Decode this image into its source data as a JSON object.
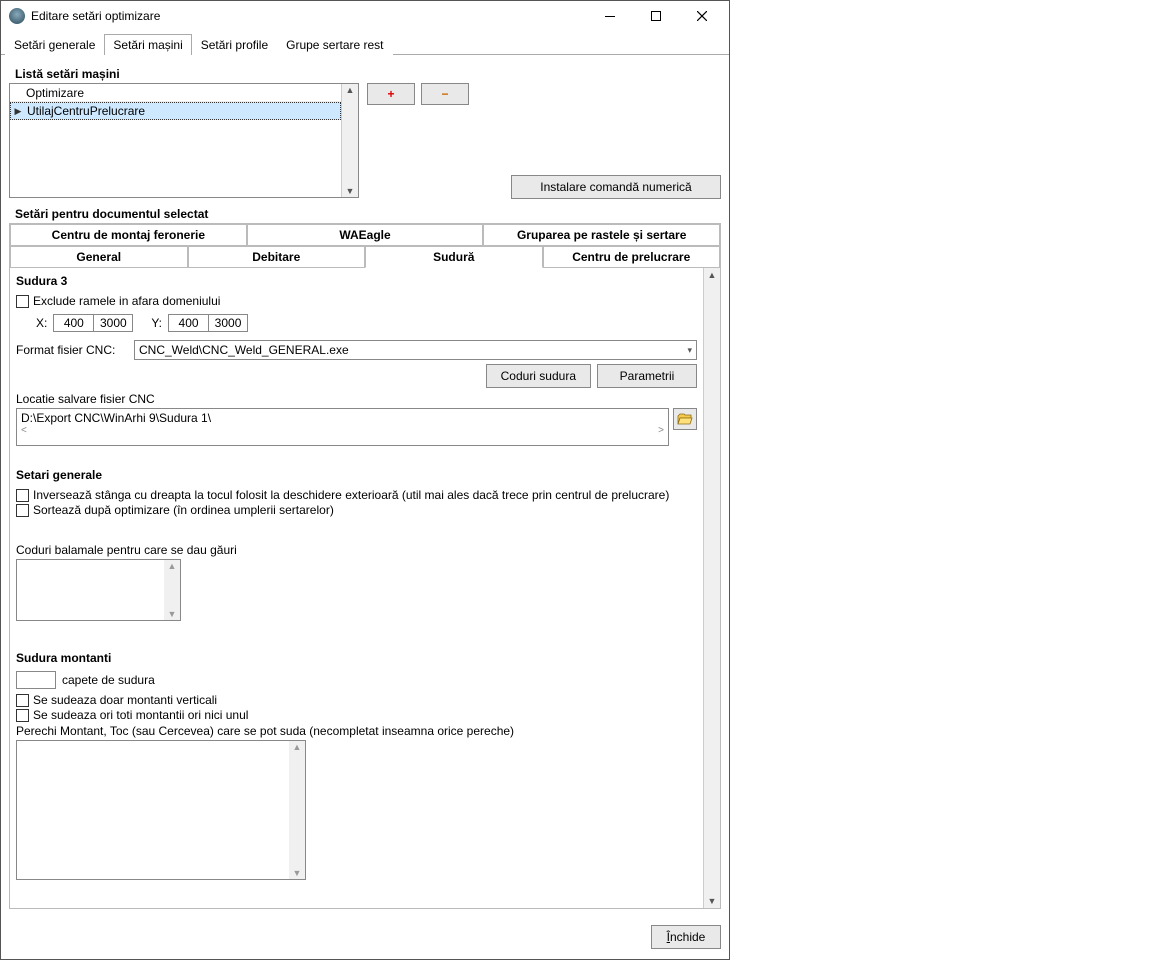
{
  "window": {
    "title": "Editare setări optimizare"
  },
  "mainTabs": {
    "items": [
      "Setări generale",
      "Setări mașini",
      "Setări profile",
      "Grupe sertare rest"
    ],
    "activeIndex": 1
  },
  "machineList": {
    "title": "Listă setări mașini",
    "header": "Optimizare",
    "items": [
      "UtilajCentruPrelucrare"
    ],
    "selectedIndex": 0
  },
  "toolbar": {
    "add": "+",
    "remove": "−",
    "install": "Instalare comandă numerică"
  },
  "docSection": {
    "title": "Setări pentru documentul selectat",
    "tabRow1": [
      "Centru de montaj feronerie",
      "WAEagle",
      "Gruparea pe rastele și sertare"
    ],
    "tabRow2": [
      "General",
      "Debitare",
      "Sudură",
      "Centru de prelucrare"
    ],
    "activeTab": "Sudură"
  },
  "sudura3": {
    "title": "Sudura 3",
    "excludeLabel": "Exclude ramele in afara domeniului",
    "xlabel": "X:",
    "x1": "400",
    "x2": "3000",
    "ylabel": "Y:",
    "y1": "400",
    "y2": "3000",
    "formatLabel": "Format fisier CNC:",
    "formatValue": "CNC_Weld\\CNC_Weld_GENERAL.exe",
    "coduriBtn": "Coduri sudura",
    "paramBtn": "Parametrii",
    "locatieLabel": "Locatie salvare fisier CNC",
    "locatieValue": "D:\\Export CNC\\WinArhi 9\\Sudura 1\\"
  },
  "setariGenerale": {
    "title": "Setari generale",
    "chk1": "Inversează stânga cu dreapta la tocul folosit la deschidere exterioară (util mai ales dacă trece prin centrul de prelucrare)",
    "chk2": "Sortează după optimizare (în ordinea umplerii sertarelor)",
    "coduriBalamale": "Coduri balamale pentru care se dau găuri"
  },
  "suduraMontanti": {
    "title": "Sudura montanti",
    "capeteLabel": "capete de sudura",
    "chk1": "Se sudeaza doar montanti verticali",
    "chk2": "Se sudeaza ori toti montantii ori nici unul",
    "perechiLabel": "Perechi Montant, Toc (sau Cercevea) care se pot suda (necompletat inseamna orice pereche)"
  },
  "footer": {
    "close": "Închide"
  }
}
